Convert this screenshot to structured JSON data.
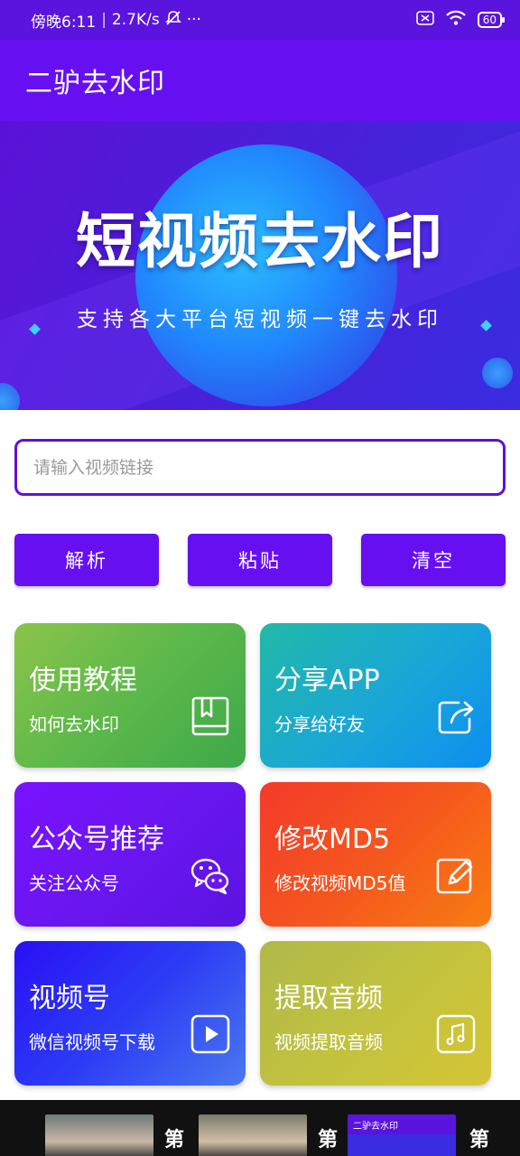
{
  "status_bar": {
    "time": "傍晚6:11",
    "speed": "2.7K/s",
    "more": "···",
    "battery": "60"
  },
  "app": {
    "title": "二驴去水印"
  },
  "banner": {
    "title": "短视频去水印",
    "subtitle": "支持各大平台短视频一键去水印"
  },
  "input": {
    "placeholder": "请输入视频链接",
    "value": ""
  },
  "buttons": {
    "parse": "解析",
    "paste": "粘贴",
    "clear": "清空"
  },
  "cards": [
    {
      "title": "使用教程",
      "subtitle": "如何去水印",
      "icon": "book-icon"
    },
    {
      "title": "分享APP",
      "subtitle": "分享给好友",
      "icon": "share-icon"
    },
    {
      "title": "公众号推荐",
      "subtitle": "关注公众号",
      "icon": "wechat-icon"
    },
    {
      "title": "修改MD5",
      "subtitle": "修改视频MD5值",
      "icon": "edit-icon"
    },
    {
      "title": "视频号",
      "subtitle": "微信视频号下载",
      "icon": "play-icon"
    },
    {
      "title": "提取音频",
      "subtitle": "视频提取音频",
      "icon": "music-icon"
    }
  ],
  "ad_strip": {
    "char1": "第",
    "char2": "第",
    "char3": "第",
    "thumb3_title": "二驴去水印"
  },
  "colors": {
    "primary": "#6610f2",
    "input_border": "#6210d8"
  }
}
